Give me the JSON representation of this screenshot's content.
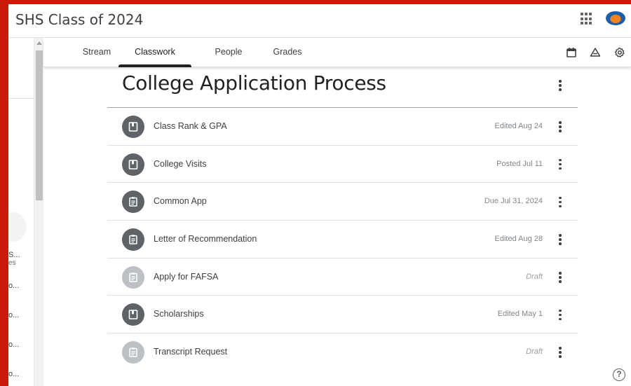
{
  "header": {
    "class_title": "SHS Class of 2024",
    "apps_icon": "apps-grid-icon",
    "avatar_icon": "gator-logo-avatar"
  },
  "tabs": [
    {
      "label": "Stream"
    },
    {
      "label": "Classwork",
      "active": true
    },
    {
      "label": "People"
    },
    {
      "label": "Grades"
    }
  ],
  "toolbar": {
    "calendar_icon": "calendar-icon",
    "drive_icon": "drive-icon",
    "settings_icon": "gear-icon"
  },
  "left_rail": {
    "items": [
      {
        "text": "S...",
        "sub": "es"
      },
      {
        "text": "o..."
      },
      {
        "text": "o..."
      },
      {
        "text": "o..."
      },
      {
        "text": "o..."
      }
    ]
  },
  "topic": {
    "title": "College Application Process"
  },
  "items": [
    {
      "title": "Class Rank & GPA",
      "status": "Edited Aug 24",
      "icon": "material-icon",
      "draft": false
    },
    {
      "title": "College Visits",
      "status": "Posted Jul 11",
      "icon": "material-icon",
      "draft": false
    },
    {
      "title": "Common App",
      "status": "Due Jul 31, 2024",
      "icon": "assignment-icon",
      "draft": false
    },
    {
      "title": "Letter of Recommendation",
      "status": "Edited Aug 28",
      "icon": "assignment-icon",
      "draft": false
    },
    {
      "title": "Apply for FAFSA",
      "status": "Draft",
      "icon": "assignment-icon",
      "draft": true
    },
    {
      "title": "Scholarships",
      "status": "Edited May 1",
      "icon": "material-icon",
      "draft": false
    },
    {
      "title": "Transcript Request",
      "status": "Draft",
      "icon": "assignment-icon",
      "draft": true
    }
  ],
  "help": {
    "label": "?"
  },
  "colors": {
    "frame": "#cc1a0a",
    "icon_dark": "#5f6368",
    "icon_draft": "#bdc1c6",
    "active_tab_underline": "#202124"
  }
}
